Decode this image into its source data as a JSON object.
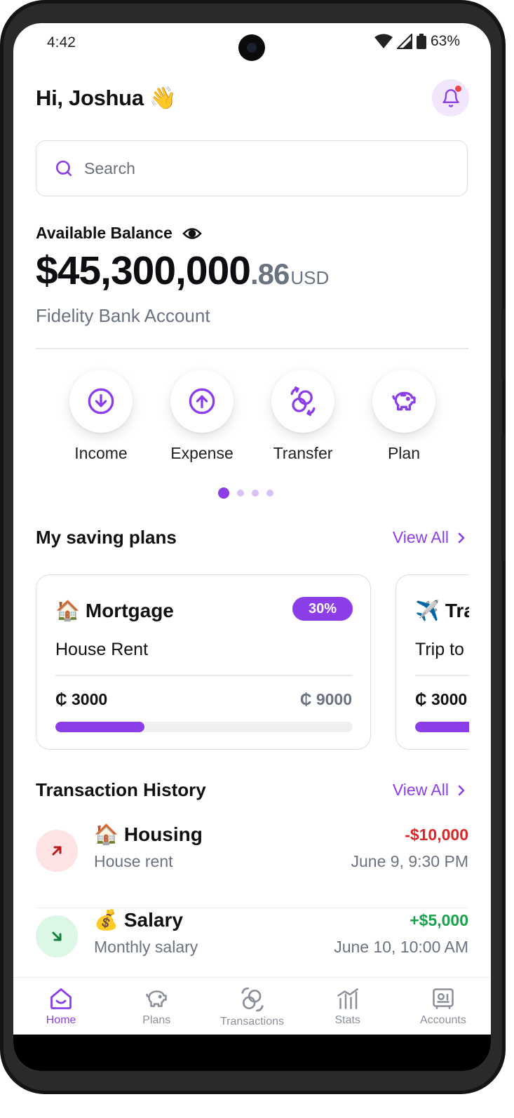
{
  "status_bar": {
    "time": "4:42",
    "battery": "63%"
  },
  "header": {
    "greeting": "Hi, Joshua",
    "greeting_emoji": "👋"
  },
  "search": {
    "placeholder": "Search"
  },
  "balance": {
    "label": "Available Balance",
    "amount_main": "$45,300,000",
    "amount_cents": ".86",
    "currency": "USD",
    "account": "Fidelity Bank Account"
  },
  "actions": [
    {
      "label": "Income",
      "icon": "arrow-down-circle-icon"
    },
    {
      "label": "Expense",
      "icon": "arrow-up-circle-icon"
    },
    {
      "label": "Transfer",
      "icon": "transfer-icon"
    },
    {
      "label": "Plan",
      "icon": "piggy-bank-icon"
    }
  ],
  "pager": {
    "count": 4,
    "active": 0
  },
  "saving_plans": {
    "title": "My saving plans",
    "view_all": "View All",
    "plans": [
      {
        "emoji": "🏠",
        "name": "Mortgage",
        "percent": "30%",
        "progress": 0.3,
        "description": "House Rent",
        "saved": "₵ 3000",
        "target": "₵ 9000"
      },
      {
        "emoji": "✈️",
        "name": "Travel",
        "description": "Trip to",
        "saved": "₵ 3000",
        "progress": 0.3
      }
    ]
  },
  "transactions": {
    "title": "Transaction History",
    "view_all": "View All",
    "items": [
      {
        "emoji": "🏠",
        "name": "Housing",
        "note": "House rent",
        "amount": "-$10,000",
        "date": "June 9, 9:30 PM",
        "type": "expense"
      },
      {
        "emoji": "💰",
        "name": "Salary",
        "note": "Monthly salary",
        "amount": "+$5,000",
        "date": "June 10, 10:00 AM",
        "type": "income"
      }
    ]
  },
  "bottom_nav": [
    {
      "label": "Home",
      "active": true
    },
    {
      "label": "Plans",
      "active": false
    },
    {
      "label": "Transactions",
      "active": false
    },
    {
      "label": "Stats",
      "active": false
    },
    {
      "label": "Accounts",
      "active": false
    }
  ],
  "colors": {
    "accent": "#8b3ee8",
    "expense": "#dc2626",
    "income": "#16a34a",
    "text": "#111111",
    "muted": "#6b7280"
  }
}
